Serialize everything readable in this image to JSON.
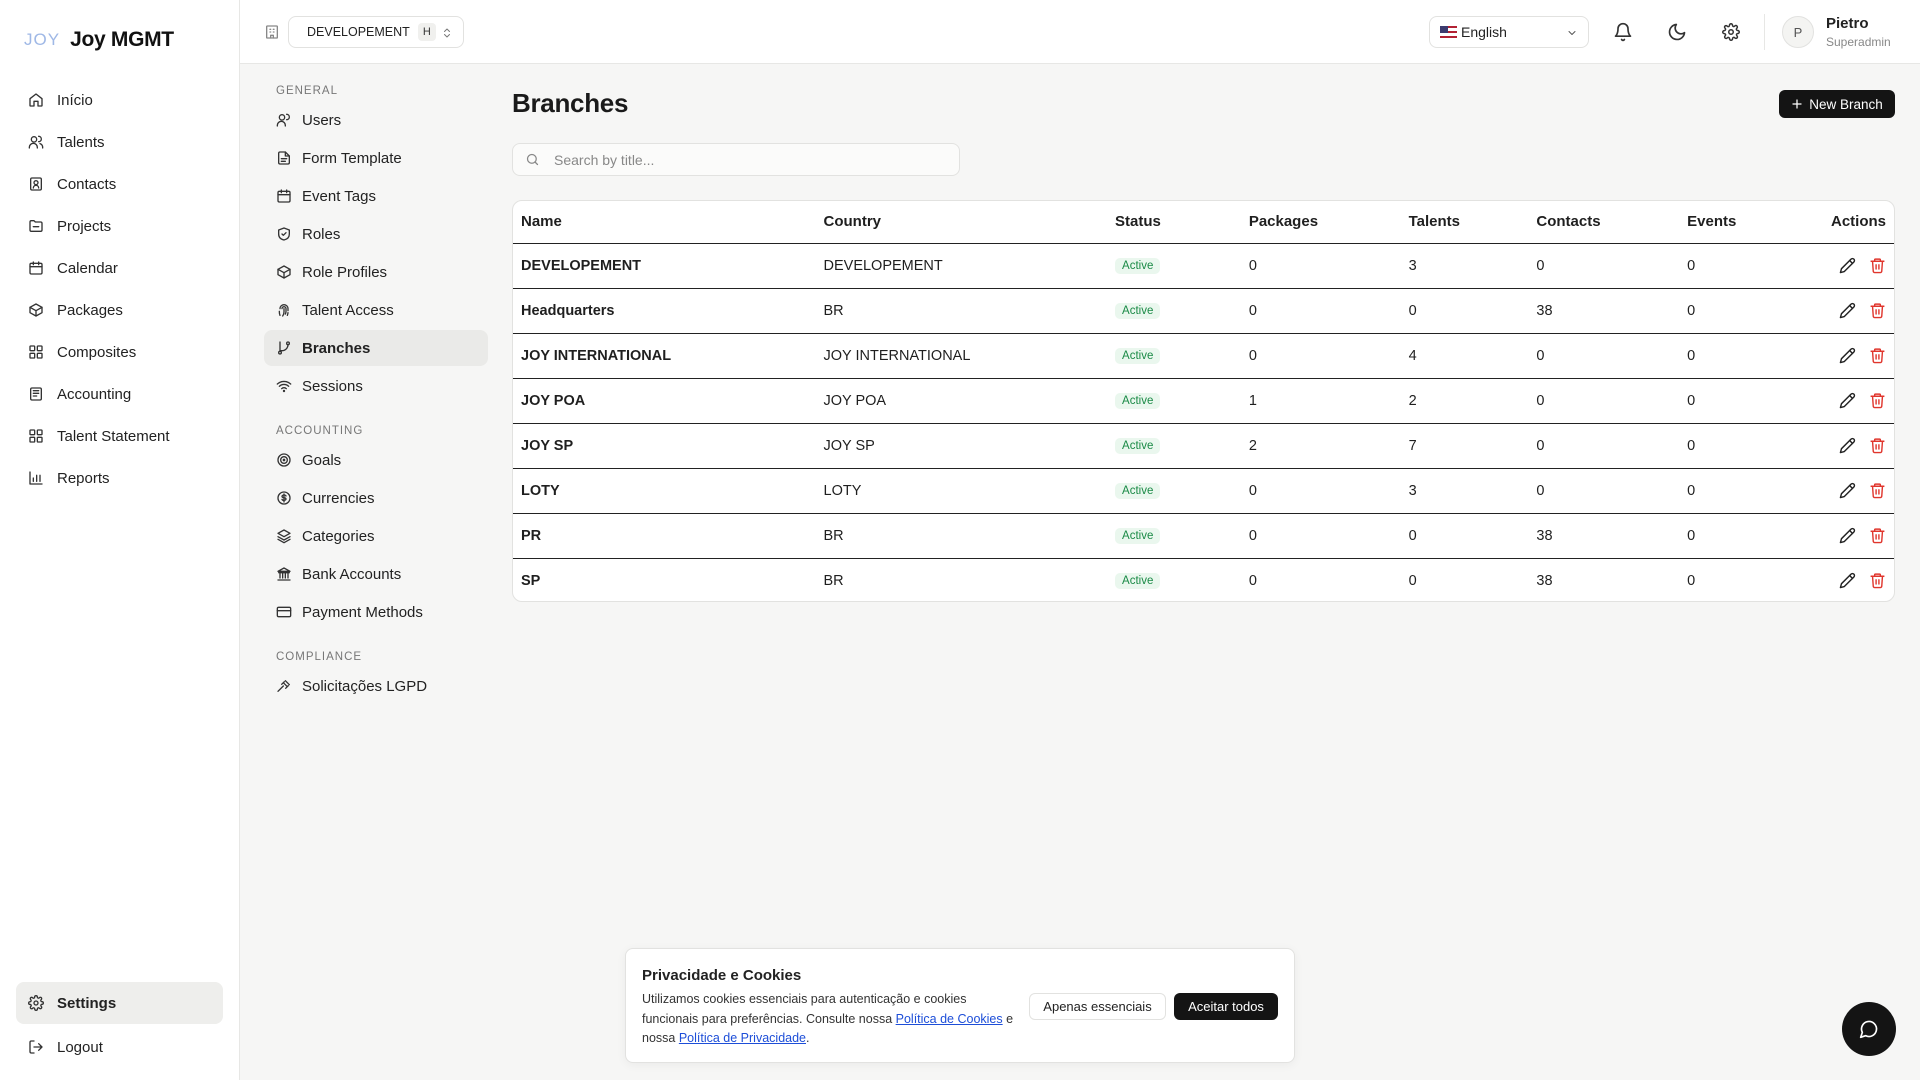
{
  "brand": {
    "logo_text": "JOY",
    "name": "Joy MGMT"
  },
  "main_nav": [
    {
      "label": "Início",
      "icon": "home-icon"
    },
    {
      "label": "Talents",
      "icon": "users-icon"
    },
    {
      "label": "Contacts",
      "icon": "contact-card-icon"
    },
    {
      "label": "Projects",
      "icon": "folder-icon"
    },
    {
      "label": "Calendar",
      "icon": "calendar-icon"
    },
    {
      "label": "Packages",
      "icon": "package-icon"
    },
    {
      "label": "Composites",
      "icon": "grid-icon"
    },
    {
      "label": "Accounting",
      "icon": "ledger-icon"
    },
    {
      "label": "Talent Statement",
      "icon": "grid-icon"
    },
    {
      "label": "Reports",
      "icon": "bar-chart-icon"
    }
  ],
  "sidebar_bottom": {
    "settings": "Settings",
    "logout": "Logout"
  },
  "topbar": {
    "org": "DEVELOPEMENT",
    "org_badge": "H",
    "language": "English",
    "user_initial": "P",
    "user_name": "Pietro",
    "user_role": "Superadmin"
  },
  "settings_nav": {
    "general_label": "General",
    "general": [
      "Users",
      "Form Template",
      "Event Tags",
      "Roles",
      "Role Profiles",
      "Talent Access",
      "Branches",
      "Sessions"
    ],
    "accounting_label": "Accounting",
    "accounting": [
      "Goals",
      "Currencies",
      "Categories",
      "Bank Accounts",
      "Payment Methods"
    ],
    "compliance_label": "Compliance",
    "compliance": [
      "Solicitações LGPD"
    ]
  },
  "page": {
    "title": "Branches",
    "new_button": "New Branch",
    "search_placeholder": "Search by title..."
  },
  "table": {
    "headers": {
      "name": "Name",
      "country": "Country",
      "status": "Status",
      "packages": "Packages",
      "talents": "Talents",
      "contacts": "Contacts",
      "events": "Events",
      "actions": "Actions"
    },
    "rows": [
      {
        "name": "DEVELOPEMENT",
        "country": "DEVELOPEMENT",
        "status": "Active",
        "packages": "0",
        "talents": "3",
        "contacts": "0",
        "events": "0"
      },
      {
        "name": "Headquarters",
        "country": "BR",
        "status": "Active",
        "packages": "0",
        "talents": "0",
        "contacts": "38",
        "events": "0"
      },
      {
        "name": "JOY INTERNATIONAL",
        "country": "JOY INTERNATIONAL",
        "status": "Active",
        "packages": "0",
        "talents": "4",
        "contacts": "0",
        "events": "0"
      },
      {
        "name": "JOY POA",
        "country": "JOY POA",
        "status": "Active",
        "packages": "1",
        "talents": "2",
        "contacts": "0",
        "events": "0"
      },
      {
        "name": "JOY SP",
        "country": "JOY SP",
        "status": "Active",
        "packages": "2",
        "talents": "7",
        "contacts": "0",
        "events": "0"
      },
      {
        "name": "LOTY",
        "country": "LOTY",
        "status": "Active",
        "packages": "0",
        "talents": "3",
        "contacts": "0",
        "events": "0"
      },
      {
        "name": "PR",
        "country": "BR",
        "status": "Active",
        "packages": "0",
        "talents": "0",
        "contacts": "38",
        "events": "0"
      },
      {
        "name": "SP",
        "country": "BR",
        "status": "Active",
        "packages": "0",
        "talents": "0",
        "contacts": "38",
        "events": "0"
      }
    ]
  },
  "cookie": {
    "title": "Privacidade e Cookies",
    "text_1": "Utilizamos cookies essenciais para autenticação e cookies funcionais para preferências. Consulte nossa ",
    "link_cookies": "Política de Cookies",
    "text_2": " e nossa ",
    "link_privacy": "Política de Privacidade",
    "text_3": ".",
    "essential_button": "Apenas essenciais",
    "accept_button": "Aceitar todos"
  },
  "colors": {
    "accent": "#141414",
    "status_active": "#1a8a46",
    "delete": "#e0362d",
    "link": "#1d4ed8"
  }
}
